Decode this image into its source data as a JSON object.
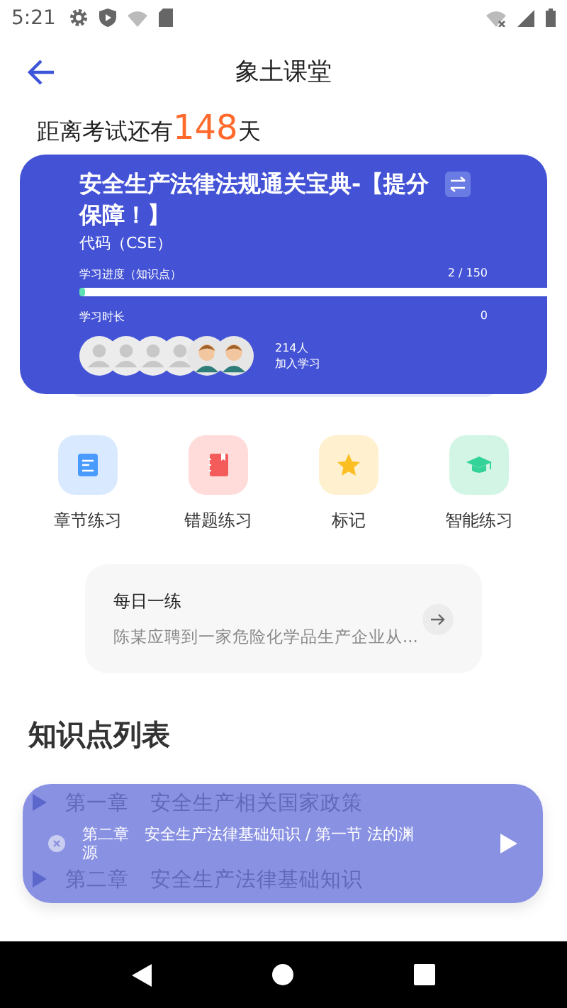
{
  "status_bar": {
    "time": "5:21"
  },
  "header": {
    "title": "象土课堂"
  },
  "countdown": {
    "prefix": "距离考试还有",
    "days": "148",
    "suffix": "天"
  },
  "course": {
    "title": "安全生产法律法规通关宝典-【提分保障！】",
    "code": "代码（CSE）",
    "progress": {
      "label": "学习进度（知识点）",
      "reading": "2 / 150",
      "level": 0.013
    },
    "duration": {
      "label": "学习时长",
      "reading": "0"
    },
    "avatars": [
      {
        "kind": "placeholder"
      },
      {
        "kind": "placeholder"
      },
      {
        "kind": "placeholder"
      },
      {
        "kind": "placeholder"
      },
      {
        "kind": "person"
      },
      {
        "kind": "person"
      }
    ],
    "learners": "214人",
    "learners_caption": "加入学习"
  },
  "features": [
    {
      "label": "章节练习",
      "kind": "book"
    },
    {
      "label": "错题练习",
      "kind": "notebook"
    },
    {
      "label": "标记",
      "kind": "star"
    },
    {
      "label": "智能练习",
      "kind": "cap"
    }
  ],
  "daily": {
    "title": "每日一练",
    "preview": "陈某应聘到一家危险化学品生产企业从..."
  },
  "knowledge": {
    "heading": "知识点列表",
    "items": [
      {
        "label": "第一章　安全生产相关国家政策"
      },
      {
        "label": "第二章　安全生产法律基础知识"
      }
    ]
  },
  "player": {
    "text": "第二章　安全生产法律基础知识 / 第一节 法的渊源"
  }
}
